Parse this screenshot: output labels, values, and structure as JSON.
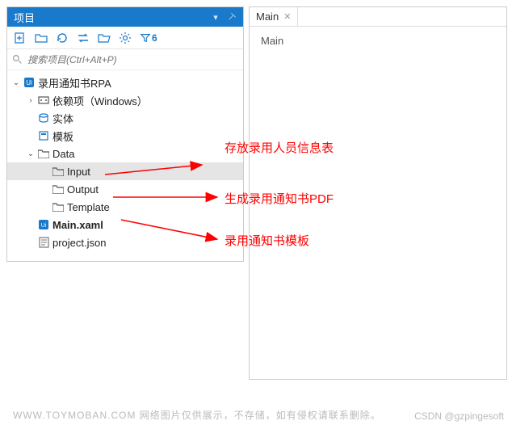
{
  "panel": {
    "title": "项目",
    "search_placeholder": "搜索项目(Ctrl+Alt+P)",
    "filter_count": "6"
  },
  "tree": {
    "root": "录用通知书RPA",
    "deps": "依赖项（Windows）",
    "entities": "实体",
    "templates": "模板",
    "data": "Data",
    "input": "Input",
    "output": "Output",
    "template": "Template",
    "main_xaml": "Main.xaml",
    "project_json": "project.json"
  },
  "editor": {
    "tab_label": "Main",
    "body_text": "Main"
  },
  "annotations": {
    "input_note": "存放录用人员信息表",
    "output_note": "生成录用通知书PDF",
    "template_note": "录用通知书模板"
  },
  "footer": {
    "left": "WWW.TOYMOBAN.COM 网络图片仅供展示，不存储，如有侵权请联系删除。",
    "right": "CSDN @gzpingesoft"
  }
}
